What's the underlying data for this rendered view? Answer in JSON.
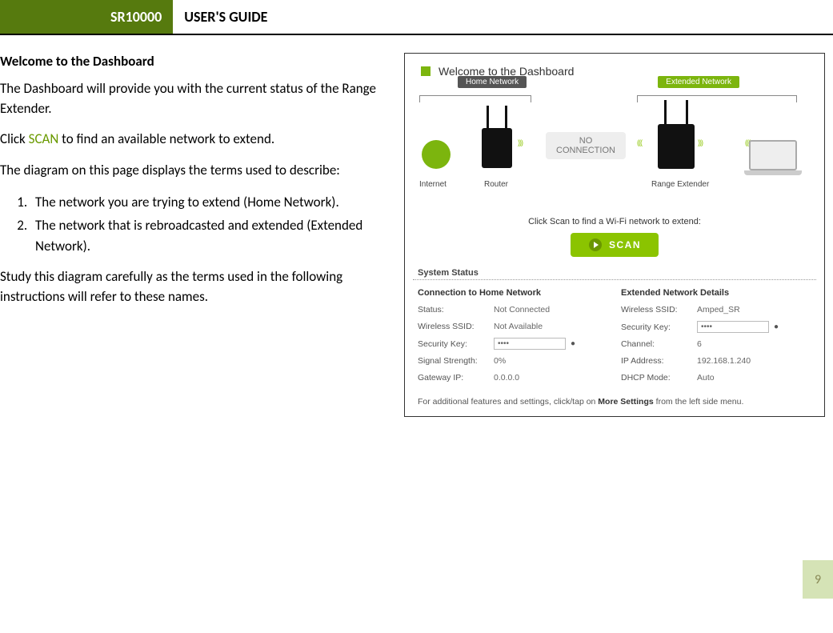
{
  "header": {
    "model": "SR10000",
    "title": "USER'S GUIDE"
  },
  "section_title": "Welcome to the Dashboard",
  "para1": "The Dashboard will provide you with the current status of the Range Extender.",
  "para2_pre": "Click ",
  "para2_scan": "SCAN",
  "para2_post": " to find an available network to extend.",
  "para3": "The diagram on this page displays the terms used to describe:",
  "list": {
    "i1": "The network you are trying to extend (Home Network).",
    "i2": "The network that is rebroadcasted and extended (Extended Network)."
  },
  "para4": "Study this diagram carefully as the terms used in the following instructions will refer to these names.",
  "ss": {
    "title": "Welcome to the Dashboard",
    "home_label": "Home Network",
    "ext_label": "Extended Network",
    "noconn1": "NO",
    "noconn2": "CONNECTION",
    "d_internet": "Internet",
    "d_router": "Router",
    "d_extender": "Range Extender",
    "scan_line": "Click Scan to find a Wi-Fi network to extend:",
    "scan_btn": "SCAN",
    "sys_status": "System Status",
    "col1_h": "Connection to Home Network",
    "col2_h": "Extended Network Details",
    "home": {
      "status_k": "Status:",
      "status_v": "Not Connected",
      "ssid_k": "Wireless SSID:",
      "ssid_v": "Not Available",
      "key_k": "Security Key:",
      "key_v": "••••",
      "signal_k": "Signal Strength:",
      "signal_v": "0%",
      "gw_k": "Gateway IP:",
      "gw_v": "0.0.0.0"
    },
    "ext": {
      "ssid_k": "Wireless SSID:",
      "ssid_v": "Amped_SR",
      "key_k": "Security Key:",
      "key_v": "••••",
      "ch_k": "Channel:",
      "ch_v": "6",
      "ip_k": "IP Address:",
      "ip_v": "192.168.1.240",
      "dhcp_k": "DHCP Mode:",
      "dhcp_v": "Auto"
    },
    "foot_pre": "For additional features and settings, click/tap on ",
    "foot_bold": "More Settings",
    "foot_post": " from the left side menu."
  },
  "page_number": "9"
}
